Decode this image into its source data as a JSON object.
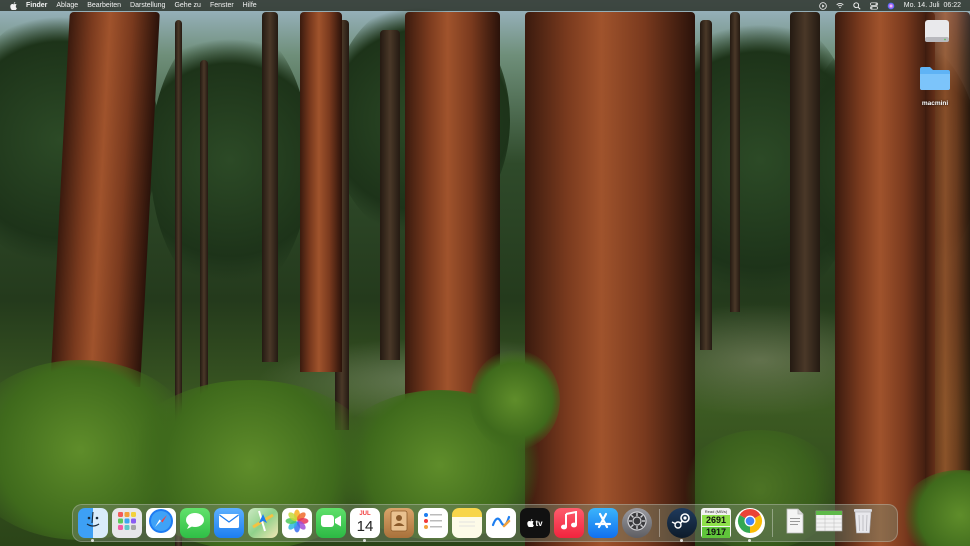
{
  "menubar": {
    "apple_icon": "apple-logo",
    "app_name": "Finder",
    "menus": [
      "Ablage",
      "Bearbeiten",
      "Darstellung",
      "Gehe zu",
      "Fenster",
      "Hilfe"
    ],
    "status_icons": [
      "play-circle-icon",
      "wifi-icon",
      "search-icon",
      "control-center-icon",
      "siri-icon"
    ],
    "clock": "Mo. 14. Juli  06:22"
  },
  "desktop": {
    "items": [
      {
        "label": "",
        "icon": "drive-icon"
      },
      {
        "label": "macmini",
        "icon": "folder-icon"
      }
    ]
  },
  "dock": {
    "apps": [
      {
        "name": "Finder",
        "icon": "finder-icon",
        "color": "#2b8cf0"
      },
      {
        "name": "Launchpad",
        "icon": "launchpad-icon",
        "color": "#e7e7ea"
      },
      {
        "name": "Safari",
        "icon": "safari-icon",
        "color": "#1e7cf3"
      },
      {
        "name": "Messages",
        "icon": "messages-icon",
        "color": "#34c759"
      },
      {
        "name": "Mail",
        "icon": "mail-icon",
        "color": "#2f8cf3"
      },
      {
        "name": "Maps",
        "icon": "maps-icon",
        "color": "#5fbf5a"
      },
      {
        "name": "Photos",
        "icon": "photos-icon",
        "color": "#ffffff"
      },
      {
        "name": "FaceTime",
        "icon": "facetime-icon",
        "color": "#34c759"
      },
      {
        "name": "Calendar",
        "icon": "calendar-icon",
        "month": "JUL",
        "day": "14"
      },
      {
        "name": "Contacts",
        "icon": "contacts-icon",
        "color": "#c6945a"
      },
      {
        "name": "Reminders",
        "icon": "reminders-icon",
        "color": "#ffffff"
      },
      {
        "name": "Notes",
        "icon": "notes-icon",
        "color": "#f7d54a"
      },
      {
        "name": "Freeform",
        "icon": "freeform-icon",
        "color": "#ffffff"
      },
      {
        "name": "TV",
        "icon": "appletv-icon",
        "label": "tv",
        "color": "#111111"
      },
      {
        "name": "Music",
        "icon": "music-icon",
        "color": "#fa3c4c"
      },
      {
        "name": "App Store",
        "icon": "appstore-icon",
        "color": "#1c8ef9"
      },
      {
        "name": "System Settings",
        "icon": "settings-icon",
        "color": "#8e8e93"
      }
    ],
    "apps_right": [
      {
        "name": "Steam",
        "icon": "steam-icon",
        "color": "#1b2838"
      },
      {
        "name": "Disk Speed Monitor",
        "icon": "disk-speed-icon",
        "header": "Read (MB/s)",
        "value1": "2691",
        "value2": "1917"
      },
      {
        "name": "Chrome",
        "icon": "chrome-icon"
      }
    ],
    "trash_section": [
      {
        "name": "Document",
        "icon": "document-icon"
      },
      {
        "name": "Activity",
        "icon": "spreadsheet-icon"
      },
      {
        "name": "Trash",
        "icon": "trash-icon"
      }
    ]
  }
}
